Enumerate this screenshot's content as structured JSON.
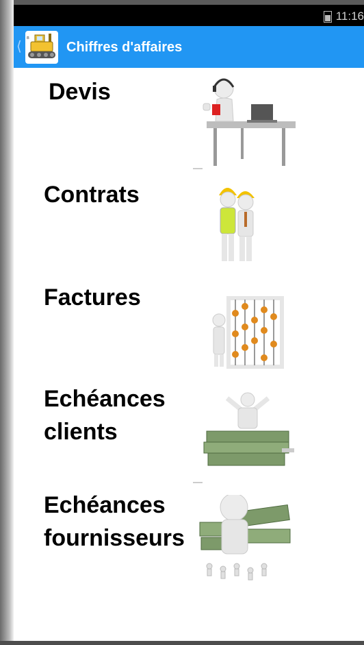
{
  "status_bar": {
    "time": "11:16"
  },
  "app_bar": {
    "title": "Chiffres d'affaires"
  },
  "menu": [
    {
      "label": "Devis",
      "icon": "support-desk-icon"
    },
    {
      "label": "Contrats",
      "icon": "construction-workers-icon"
    },
    {
      "label": "Factures",
      "icon": "abacus-icon"
    },
    {
      "label_line1": "Echéances",
      "label_line2": "clients",
      "icon": "money-stack-icon"
    },
    {
      "label_line1": "Echéances",
      "label_line2": "fournisseurs",
      "icon": "money-crowd-icon"
    }
  ],
  "colors": {
    "app_bar": "#2196F3",
    "status_bar": "#000000",
    "background": "#ffffff"
  }
}
